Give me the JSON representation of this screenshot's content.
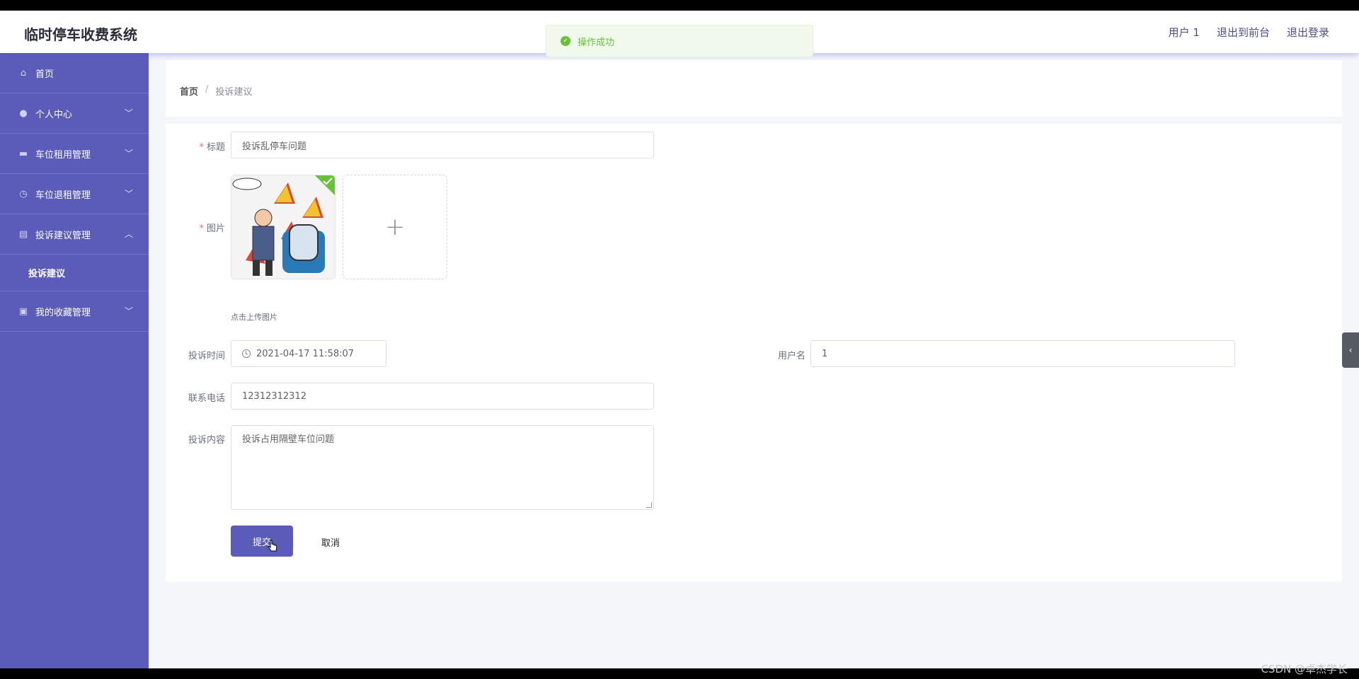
{
  "app": {
    "title": "临时停车收费系统"
  },
  "header": {
    "links": [
      "用户 1",
      "退出到前台",
      "退出登录"
    ]
  },
  "toast": {
    "message": "操作成功"
  },
  "sidebar": {
    "items": [
      {
        "label": "首页",
        "icon": "home-icon"
      },
      {
        "label": "个人中心",
        "icon": "user-icon"
      },
      {
        "label": "车位租用管理",
        "icon": "briefcase-icon"
      },
      {
        "label": "车位退租管理",
        "icon": "clock-icon"
      },
      {
        "label": "投诉建议管理",
        "icon": "clipboard-icon"
      },
      {
        "label": "投诉建议",
        "icon": ""
      },
      {
        "label": "我的收藏管理",
        "icon": "clipboard-check-icon"
      }
    ]
  },
  "breadcrumb": {
    "home": "首页",
    "separator": "/",
    "current": "投诉建议"
  },
  "form": {
    "title_label": "标题",
    "title_value": "投诉乱停车问题",
    "image_label": "图片",
    "upload_hint": "点击上传图片",
    "time_label": "投诉时间",
    "time_value": "2021-04-17 11:58:07",
    "username_label": "用户名",
    "username_value": "1",
    "phone_label": "联系电话",
    "phone_value": "12312312312",
    "content_label": "投诉内容",
    "content_value": "投诉占用隔壁车位问题",
    "submit": "提交",
    "cancel": "取消"
  },
  "watermark": "CSDN @卓杰学长",
  "colors": {
    "primary": "#5b5cba",
    "success": "#67c23a",
    "required": "#f56c6c"
  }
}
